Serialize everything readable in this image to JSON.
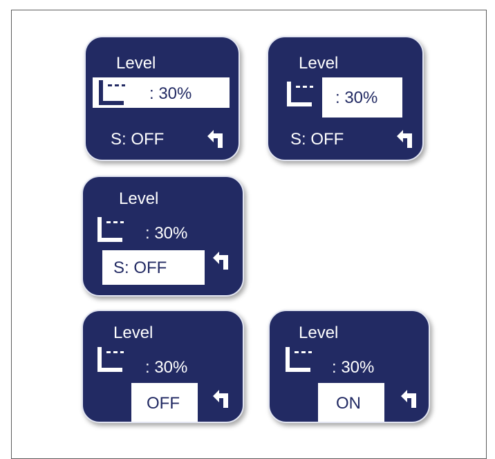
{
  "panels": [
    {
      "title": "Level",
      "level_value": ": 30%",
      "status_value": "S:  OFF",
      "selected": "level_value_wide"
    },
    {
      "title": "Level",
      "level_value": ": 30%",
      "status_value": "S:  OFF",
      "selected": "level_value"
    },
    {
      "title": "Level",
      "level_value": ": 30%",
      "status_value": "S:  OFF",
      "selected": "status"
    },
    {
      "title": "Level",
      "level_value": ": 30%",
      "status_value": "OFF",
      "selected": "status_edit"
    },
    {
      "title": "Level",
      "level_value": ": 30%",
      "status_value": "ON",
      "selected": "status_edit"
    }
  ],
  "icons": {
    "level": "level-icon",
    "back": "return-arrow-icon"
  },
  "colors": {
    "panel_background": "#222a63",
    "panel_border": "#e3e6f2",
    "highlight": "#ffffff"
  }
}
